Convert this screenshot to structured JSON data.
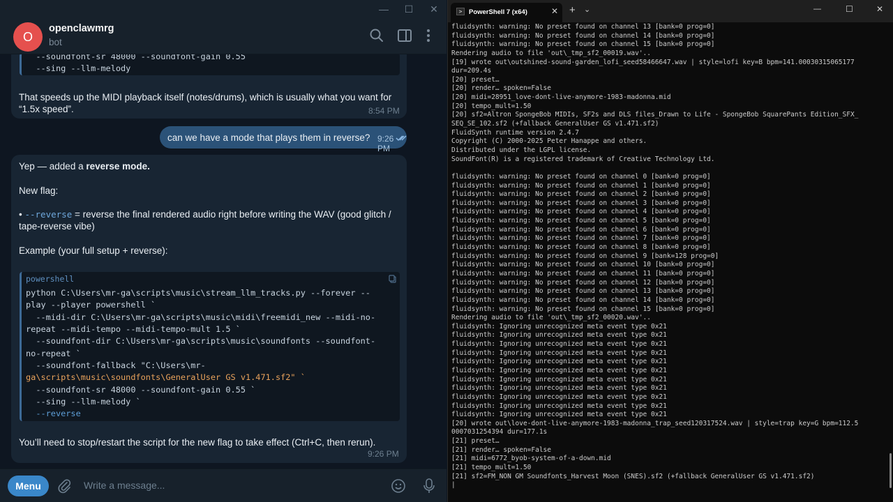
{
  "telegram": {
    "chat_name": "openclawmrg",
    "chat_subtitle": "bot",
    "avatar_letter": "O",
    "avatar_color": "#e5504e",
    "accent": "#3a87c9",
    "top_code_tail": [
      "  --soundfont-sr 48000 --soundfont-gain 0.55",
      "  --sing --llm-melody"
    ],
    "msg1": {
      "line1": "That speeds up the MIDI playback itself (notes/drums), which is usually what you want for",
      "line2": "“1.5x speed”.",
      "time": "8:54 PM"
    },
    "outgoing": {
      "text": "can we have a mode that plays them in reverse?",
      "time": "9:26 PM"
    },
    "msg2": {
      "intro_plain": "Yep — added a ",
      "intro_bold": "reverse mode.",
      "new_flag": "New flag:",
      "bullet_prefix": "• ",
      "flag": "--reverse",
      "bullet_text1": " = reverse the final rendered audio right before writing the WAV (good glitch /",
      "bullet_text2": "tape-reverse vibe)",
      "example": "Example (your full setup + reverse):",
      "code_lang": "powershell",
      "code_lines": [
        "python C:\\Users\\mr-ga\\scripts\\music\\stream_llm_tracks.py --forever --",
        "play --player powershell `",
        "  --midi-dir C:\\Users\\mr-ga\\scripts\\music\\midi\\freemidi_new --midi-no-",
        "repeat --midi-tempo --midi-tempo-mult 1.5 `",
        "  --soundfont-dir C:\\Users\\mr-ga\\scripts\\music\\soundfonts --soundfont-",
        "no-repeat `",
        "  --soundfont-fallback \"C:\\Users\\mr-",
        "ga\\scripts\\music\\soundfonts\\GeneralUser GS v1.471.sf2\" `",
        "  --soundfont-sr 48000 --soundfont-gain 0.55 `",
        "  --sing --llm-melody `",
        "  --reverse"
      ],
      "outro": "You’ll need to stop/restart the script for the new flag to take effect (Ctrl+C, then rerun).",
      "time": "9:26 PM"
    },
    "compose": {
      "menu_label": "Menu",
      "placeholder": "Write a message..."
    }
  },
  "terminal": {
    "tab_title": "PowerShell 7 (x64)",
    "lines": [
      "fluidsynth: warning: No preset found on channel 13 [bank=0 prog=0]",
      "fluidsynth: warning: No preset found on channel 14 [bank=0 prog=0]",
      "fluidsynth: warning: No preset found on channel 15 [bank=0 prog=0]",
      "Rendering audio to file 'out\\_tmp_sf2_00019.wav'..",
      "[19] wrote out\\outshined-sound-garden_lofi_seed58466647.wav | style=lofi key=B bpm=141.00030315065177",
      "dur=209.4s",
      "[20] preset…",
      "[20] render… spoken=False",
      "[20] midi=28951_love-dont-live-anymore-1983-madonna.mid",
      "[20] tempo_mult=1.50",
      "[20] sf2=Altron SpongeBob MIDIs, SF2s and DLS files_Drawn to Life - SpongeBob SquarePants Edition_SFX_",
      "SEQ_SE_102.sf2 (+fallback GeneralUser GS v1.471.sf2)",
      "FluidSynth runtime version 2.4.7",
      "Copyright (C) 2000-2025 Peter Hanappe and others.",
      "Distributed under the LGPL license.",
      "SoundFont(R) is a registered trademark of Creative Technology Ltd.",
      "",
      "fluidsynth: warning: No preset found on channel 0 [bank=0 prog=0]",
      "fluidsynth: warning: No preset found on channel 1 [bank=0 prog=0]",
      "fluidsynth: warning: No preset found on channel 2 [bank=0 prog=0]",
      "fluidsynth: warning: No preset found on channel 3 [bank=0 prog=0]",
      "fluidsynth: warning: No preset found on channel 4 [bank=0 prog=0]",
      "fluidsynth: warning: No preset found on channel 5 [bank=0 prog=0]",
      "fluidsynth: warning: No preset found on channel 6 [bank=0 prog=0]",
      "fluidsynth: warning: No preset found on channel 7 [bank=0 prog=0]",
      "fluidsynth: warning: No preset found on channel 8 [bank=0 prog=0]",
      "fluidsynth: warning: No preset found on channel 9 [bank=128 prog=0]",
      "fluidsynth: warning: No preset found on channel 10 [bank=0 prog=0]",
      "fluidsynth: warning: No preset found on channel 11 [bank=0 prog=0]",
      "fluidsynth: warning: No preset found on channel 12 [bank=0 prog=0]",
      "fluidsynth: warning: No preset found on channel 13 [bank=0 prog=0]",
      "fluidsynth: warning: No preset found on channel 14 [bank=0 prog=0]",
      "fluidsynth: warning: No preset found on channel 15 [bank=0 prog=0]",
      "Rendering audio to file 'out\\_tmp_sf2_00020.wav'..",
      "fluidsynth: Ignoring unrecognized meta event type 0x21",
      "fluidsynth: Ignoring unrecognized meta event type 0x21",
      "fluidsynth: Ignoring unrecognized meta event type 0x21",
      "fluidsynth: Ignoring unrecognized meta event type 0x21",
      "fluidsynth: Ignoring unrecognized meta event type 0x21",
      "fluidsynth: Ignoring unrecognized meta event type 0x21",
      "fluidsynth: Ignoring unrecognized meta event type 0x21",
      "fluidsynth: Ignoring unrecognized meta event type 0x21",
      "fluidsynth: Ignoring unrecognized meta event type 0x21",
      "fluidsynth: Ignoring unrecognized meta event type 0x21",
      "fluidsynth: Ignoring unrecognized meta event type 0x21",
      "[20] wrote out\\love-dont-live-anymore-1983-madonna_trap_seed120317524.wav | style=trap key=G bpm=112.5",
      "0007031254394 dur=177.1s",
      "[21] preset…",
      "[21] render… spoken=False",
      "[21] midi=6772_byob-system-of-a-down.mid",
      "[21] tempo_mult=1.50",
      "[21] sf2=FM_NON GM Soundfonts_Harvest Moon (SNES).sf2 (+fallback GeneralUser GS v1.471.sf2)",
      "|"
    ]
  }
}
